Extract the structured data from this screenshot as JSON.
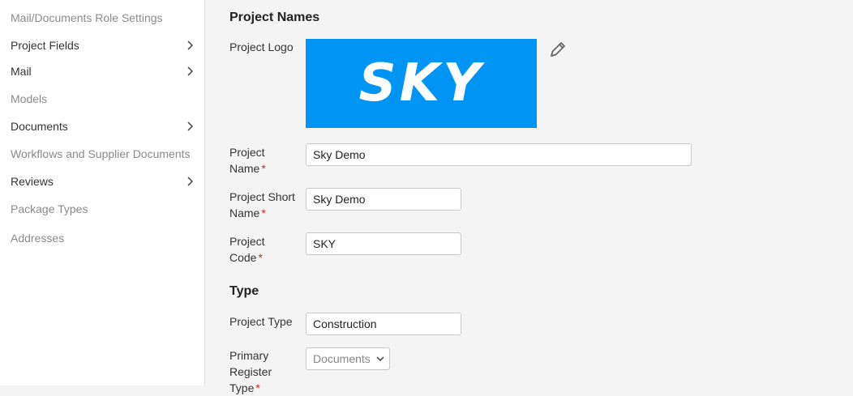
{
  "sidebar": {
    "items": [
      {
        "label": "Mail/Documents Role Settings",
        "has_children": false
      },
      {
        "label": "Project Fields",
        "has_children": true
      },
      {
        "label": "Mail",
        "has_children": true
      },
      {
        "label": "Models",
        "has_children": false
      },
      {
        "label": "Documents",
        "has_children": true
      },
      {
        "label": "Workflows and Supplier Documents",
        "has_children": false
      },
      {
        "label": "Reviews",
        "has_children": true
      },
      {
        "label": "Package Types",
        "has_children": false
      },
      {
        "label": "Addresses",
        "has_children": false
      }
    ]
  },
  "project_names": {
    "title": "Project Names",
    "logo_label": "Project Logo",
    "logo_text": "SKY",
    "name_label_1": "Project",
    "name_label_2": "Name",
    "name_value": "Sky Demo",
    "short_label_1": "Project Short",
    "short_label_2": "Name",
    "short_value": "Sky Demo",
    "code_label_1": "Project",
    "code_label_2": "Code",
    "code_value": "SKY",
    "required_mark": "*"
  },
  "type": {
    "title": "Type",
    "project_type_label": "Project Type",
    "project_type_value": "Construction",
    "primary_label_1": "Primary",
    "primary_label_2": "Register",
    "primary_label_3": "Type",
    "primary_value": "Documents"
  },
  "colors": {
    "logo_background": "#0094f5",
    "required": "#c62828"
  },
  "icons": {
    "edit": "pencil-icon",
    "expand": "chevron-right-icon",
    "select": "chevron-down-icon"
  }
}
